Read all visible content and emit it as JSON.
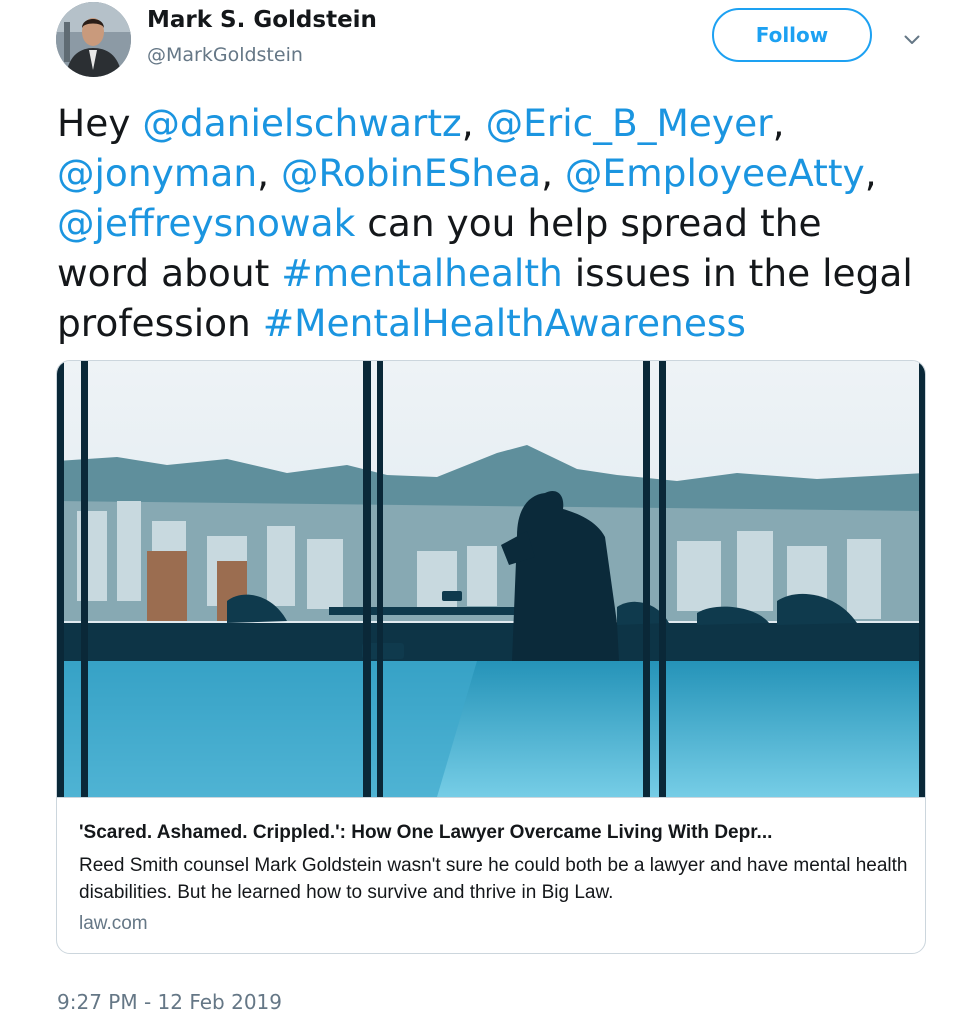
{
  "user": {
    "name": "Mark S. Goldstein",
    "handle": "@MarkGoldstein",
    "follow_label": "Follow"
  },
  "tweet": {
    "line1": {
      "t1": "Hey ",
      "m1": "@danielschwartz",
      "t2": ", ",
      "m2": "@Eric_B_Meyer",
      "t3": ","
    },
    "line2": {
      "m1": "@jonyman",
      "t1": ", ",
      "m2": "@RobinEShea",
      "t2": ", ",
      "m3": "@EmployeeAtty",
      "t3": ","
    },
    "line3": {
      "m1": "@jeffreysnowak",
      "t1": " can you help spread the"
    },
    "line4": {
      "t1": "word about ",
      "h1": "#mentalhealth",
      "t2": " issues in the legal"
    },
    "line5": {
      "t1": "profession ",
      "h1": "#MentalHealthAwareness"
    }
  },
  "card": {
    "title": "'Scared. Ashamed. Crippled.': How One Lawyer Overcame Living With Depr...",
    "description": "Reed Smith counsel Mark Goldstein wasn't sure he could both be a lawyer and have mental health disabilities. But he learned how to survive and thrive in Big Law.",
    "domain": "law.com"
  },
  "timestamp": "9:27 PM - 12 Feb 2019",
  "colors": {
    "link": "#1b95e0",
    "accent": "#1da1f2",
    "secondary_text": "#657786"
  },
  "icons": {
    "caret": "chevron-down-icon"
  }
}
